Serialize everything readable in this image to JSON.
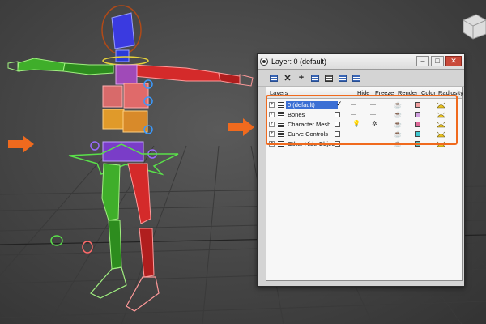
{
  "dialog": {
    "title": "Layer: 0 (default)",
    "window_buttons": {
      "minimize": "–",
      "restore": "□",
      "close": "✕"
    },
    "toolbar": [
      {
        "name": "create-layer-icon",
        "glyph": ""
      },
      {
        "name": "delete-layer-icon",
        "glyph": "✕"
      },
      {
        "name": "add-to-layer-icon",
        "glyph": "+"
      },
      {
        "name": "select-objects-icon",
        "glyph": ""
      },
      {
        "name": "highlight-selected-icon",
        "glyph": ""
      },
      {
        "name": "hide-unhide-icon",
        "glyph": ""
      },
      {
        "name": "freeze-unfreeze-icon",
        "glyph": ""
      }
    ]
  },
  "columns": {
    "layers": "Layers",
    "hide": "Hide",
    "freeze": "Freeze",
    "render": "Render",
    "color": "Color",
    "radiosity": "Radiosity"
  },
  "layers": [
    {
      "name": "0 (default)",
      "selected": true,
      "active_check": "✓",
      "hide_state": "dash",
      "freeze_state": "dash",
      "color": "#f0a0a0"
    },
    {
      "name": "Bones",
      "selected": false,
      "hide_state": "dash",
      "freeze_state": "dash",
      "color": "#d0a0e0"
    },
    {
      "name": "Character Mesh",
      "selected": false,
      "hide_state": "bulb",
      "freeze_state": "snowflake",
      "color": "#e06a9a"
    },
    {
      "name": "Curve Controls",
      "selected": false,
      "hide_state": "dash",
      "freeze_state": "dash",
      "color": "#40c8d0"
    },
    {
      "name": "Other Hide Objects",
      "selected": false,
      "hide_state": "dash",
      "freeze_state": "dash",
      "color": "#50c0c0"
    }
  ],
  "colors": {
    "highlight_orange": "#f06a1e",
    "selection_blue": "#3b6fd4",
    "bone_green": "#3fae2a",
    "bone_red": "#d42a2a",
    "bone_purple": "#7a3dc8",
    "bone_blue": "#2a3ad8"
  }
}
